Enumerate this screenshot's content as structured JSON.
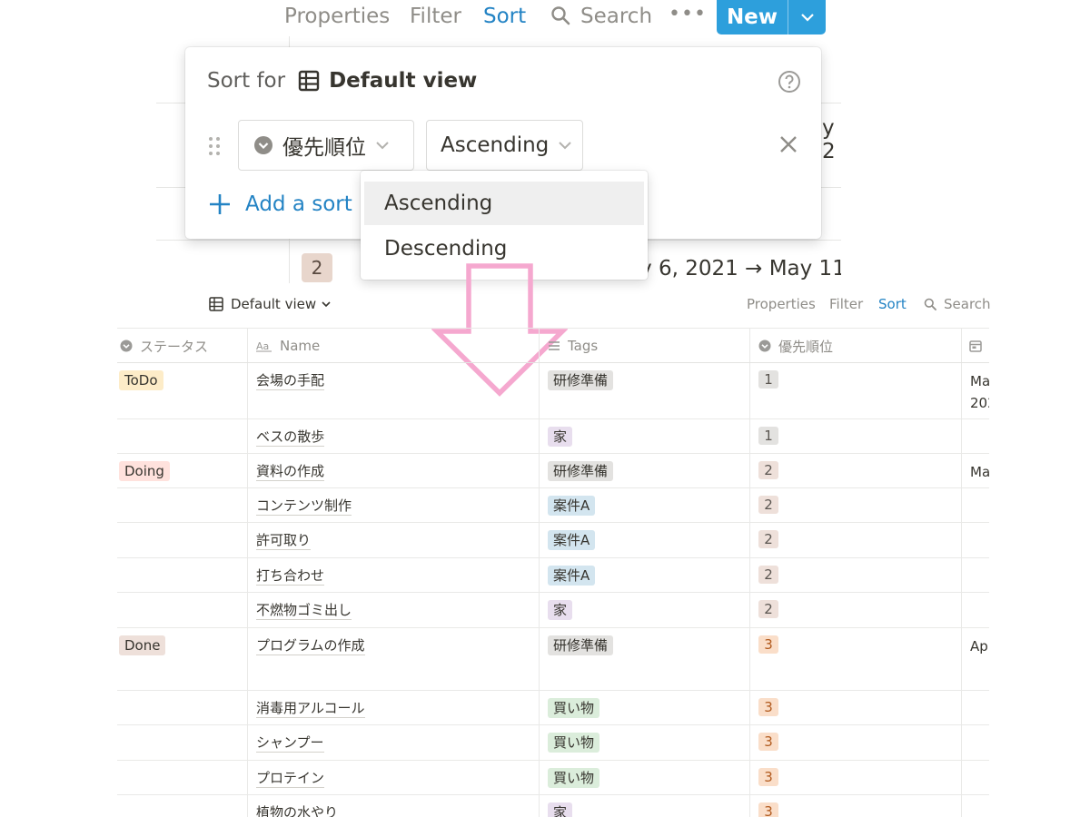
{
  "top": {
    "toolbar": {
      "properties": "Properties",
      "filter": "Filter",
      "sort": "Sort",
      "search": "Search",
      "more": "•••",
      "new_button": "New"
    },
    "background": {
      "badge": "2",
      "date_range": "ay 6, 2021 → May 11",
      "right_fragment": "y 2"
    },
    "sort_popup": {
      "title_prefix": "Sort for",
      "view_name": "Default view",
      "property": "優先順位",
      "direction": "Ascending",
      "add_sort": "Add a sort",
      "direction_menu": {
        "options": [
          "Ascending",
          "Descending"
        ],
        "highlighted": "Ascending"
      }
    }
  },
  "view_bar": {
    "view_name": "Default view",
    "properties": "Properties",
    "filter": "Filter",
    "sort": "Sort",
    "search": "Search"
  },
  "table": {
    "columns": [
      "ステータス",
      "Name",
      "Tags",
      "優先順位"
    ],
    "rows": [
      {
        "status": "ToDo",
        "name": "会場の手配",
        "tag": "研修準備",
        "priority": "1",
        "date": "Ma"
      },
      {
        "status": "",
        "name": "ベスの散歩",
        "tag": "家",
        "priority": "1",
        "date": ""
      },
      {
        "status": "Doing",
        "name": "資料の作成",
        "tag": "研修準備",
        "priority": "2",
        "date": "Ma"
      },
      {
        "status": "",
        "name": "コンテンツ制作",
        "tag": "案件A",
        "priority": "2",
        "date": ""
      },
      {
        "status": "",
        "name": "許可取り",
        "tag": "案件A",
        "priority": "2",
        "date": ""
      },
      {
        "status": "",
        "name": "打ち合わせ",
        "tag": "案件A",
        "priority": "2",
        "date": ""
      },
      {
        "status": "",
        "name": "不燃物ゴミ出し",
        "tag": "家",
        "priority": "2",
        "date": ""
      },
      {
        "status": "Done",
        "name": "プログラムの作成",
        "tag": "研修準備",
        "priority": "3",
        "date": "Ap"
      },
      {
        "status": "",
        "name": "消毒用アルコール",
        "tag": "買い物",
        "priority": "3",
        "date": ""
      },
      {
        "status": "",
        "name": "シャンプー",
        "tag": "買い物",
        "priority": "3",
        "date": ""
      },
      {
        "status": "",
        "name": "プロテイン",
        "tag": "買い物",
        "priority": "3",
        "date": ""
      },
      {
        "status": "",
        "name": "植物の水やり",
        "tag": "家",
        "priority": "3",
        "date": ""
      }
    ],
    "date_second_line": "202",
    "colors": {
      "status": {
        "ToDo": "#fdecc8",
        "Doing": "#ffe2dd",
        "Done": "#eee0da"
      },
      "tags": {
        "研修準備": "#e3e2e0",
        "家": "#e8deee",
        "案件A": "#d3e5ef",
        "買い物": "#dbeddb"
      },
      "priority": {
        "1": "#e3e2e0",
        "2": "#eee0da",
        "3": "#fadec9"
      }
    }
  },
  "annotation": {
    "arrow_color": "#f5a8cf"
  }
}
